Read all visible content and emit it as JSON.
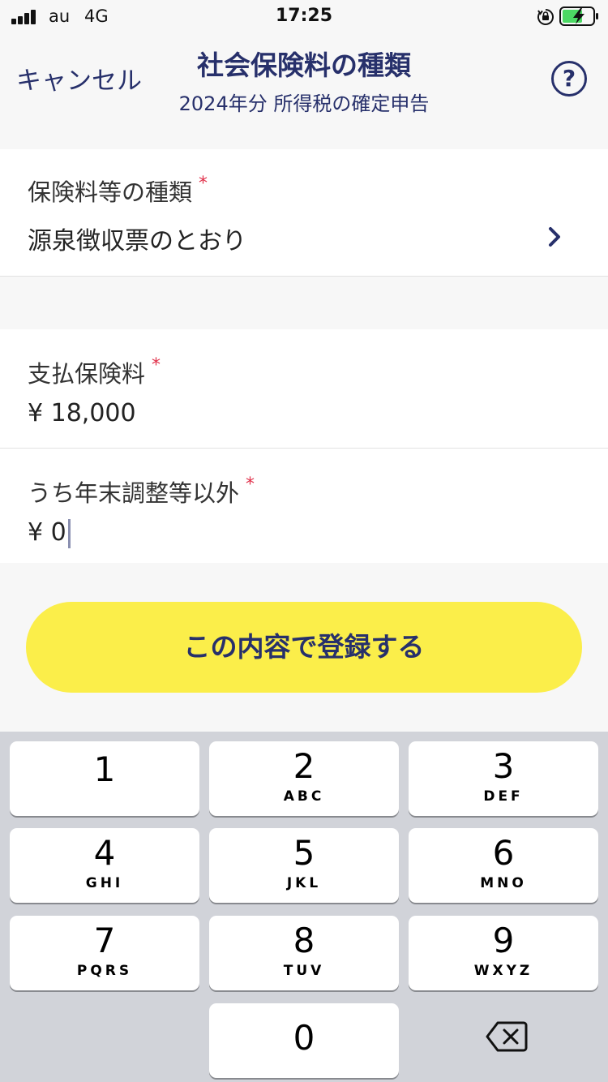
{
  "status_bar": {
    "carrier": "au",
    "network": "4G",
    "time": "17:25",
    "icons": [
      "signal-icon",
      "orientation-lock-icon",
      "battery-charging-icon"
    ]
  },
  "header": {
    "cancel_label": "キャンセル",
    "title": "社会保険料の種類",
    "subtitle": "2024年分 所得税の確定申告",
    "help_label": "?"
  },
  "form": {
    "type_field": {
      "label": "保険料等の種類",
      "required_mark": "*",
      "value": "源泉徴収票のとおり"
    },
    "paid_field": {
      "label": "支払保険料",
      "required_mark": "*",
      "value": "¥ 18,000"
    },
    "other_field": {
      "label": "うち年末調整等以外",
      "required_mark": "*",
      "value": "¥ 0"
    }
  },
  "submit_label": "この内容で登録する",
  "keypad": {
    "keys": [
      {
        "num": "1",
        "letters": ""
      },
      {
        "num": "2",
        "letters": "ABC"
      },
      {
        "num": "3",
        "letters": "DEF"
      },
      {
        "num": "4",
        "letters": "GHI"
      },
      {
        "num": "5",
        "letters": "JKL"
      },
      {
        "num": "6",
        "letters": "MNO"
      },
      {
        "num": "7",
        "letters": "PQRS"
      },
      {
        "num": "8",
        "letters": "TUV"
      },
      {
        "num": "9",
        "letters": "WXYZ"
      },
      {
        "num": "0",
        "letters": ""
      }
    ]
  },
  "colors": {
    "brand_navy": "#27306b",
    "cta_yellow": "#fbee4a",
    "required_red": "#e0304a",
    "keypad_bg": "#d1d3d9"
  }
}
